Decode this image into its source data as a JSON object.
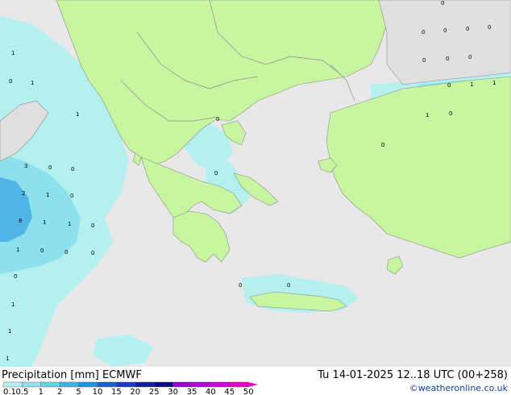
{
  "footer": {
    "title": "Precipitation [mm] ECMWF",
    "valid_time": "Tu 14-01-2025 12..18 UTC (00+258)",
    "credit": "©weatheronline.co.uk"
  },
  "legend": {
    "labels": [
      "0.1",
      "0.5",
      "1",
      "2",
      "5",
      "10",
      "15",
      "20",
      "25",
      "30",
      "35",
      "40",
      "45",
      "50"
    ],
    "colors": [
      "#b4f0f0",
      "#8ce1ec",
      "#64d2e6",
      "#3cb4e6",
      "#1e96e1",
      "#1a64d2",
      "#1a3cc8",
      "#10209a",
      "#0a0a82",
      "#9b00d2",
      "#b400dc",
      "#cd00e1",
      "#e600c8"
    ]
  },
  "map_colors": {
    "sea": "#e8e8e8",
    "land": "#c8f5a0",
    "other_land": "#e8e8e8",
    "precip_light": "#b4f0f0",
    "precip_mid": "#8ce1ec",
    "precip_heavy": "#50b4e6",
    "border": "#8c8c8c"
  },
  "map_labels": [
    {
      "text": "1"
    },
    {
      "text": "0"
    },
    {
      "text": "1"
    },
    {
      "text": "1"
    },
    {
      "text": "3"
    },
    {
      "text": "0"
    },
    {
      "text": "0"
    },
    {
      "text": "2"
    },
    {
      "text": "1"
    },
    {
      "text": "0"
    },
    {
      "text": "8"
    },
    {
      "text": "1"
    },
    {
      "text": "1"
    },
    {
      "text": "0"
    },
    {
      "text": "1"
    },
    {
      "text": "0"
    },
    {
      "text": "0"
    },
    {
      "text": "0"
    },
    {
      "text": "0"
    },
    {
      "text": "1"
    },
    {
      "text": "1"
    },
    {
      "text": "1"
    },
    {
      "text": "0"
    },
    {
      "text": "0"
    },
    {
      "text": "0"
    },
    {
      "text": "0"
    },
    {
      "text": "0"
    },
    {
      "text": "0"
    },
    {
      "text": "0"
    },
    {
      "text": "0"
    },
    {
      "text": "0"
    },
    {
      "text": "1"
    },
    {
      "text": "1"
    },
    {
      "text": "0"
    },
    {
      "text": "1"
    },
    {
      "text": "0"
    },
    {
      "text": "0"
    },
    {
      "text": "0"
    },
    {
      "text": "0"
    },
    {
      "text": "0"
    }
  ]
}
